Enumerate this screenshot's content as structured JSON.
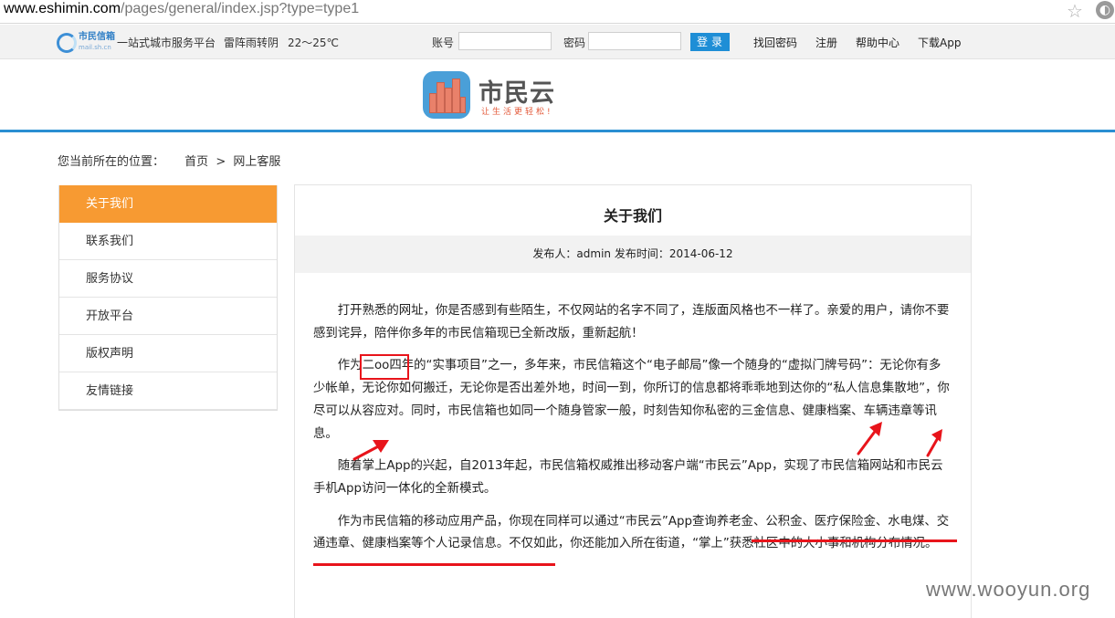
{
  "browser": {
    "url_domain": "www.eshimin.com",
    "url_path": "/pages/general/index.jsp?type=type1"
  },
  "topbar": {
    "logo_text": "市民信箱",
    "logo_sub": "mail.sh.cn",
    "slogan": "一站式城市服务平台",
    "weather": "雷阵雨转阴",
    "temperature": "22～25℃",
    "account_label": "账号",
    "account_value": "",
    "password_label": "密码",
    "password_value": "",
    "login_label": "登录",
    "links": [
      "找回密码",
      "注册",
      "帮助中心",
      "下载App"
    ]
  },
  "header": {
    "brand": "市民云",
    "brand_sub": "让生活更轻松!"
  },
  "breadcrumb": {
    "label": "您当前所在的位置：",
    "home": "首页",
    "separator": ">",
    "current": "网上客服"
  },
  "sidebar": {
    "items": [
      {
        "label": "关于我们",
        "active": true
      },
      {
        "label": "联系我们",
        "active": false
      },
      {
        "label": "服务协议",
        "active": false
      },
      {
        "label": "开放平台",
        "active": false
      },
      {
        "label": "版权声明",
        "active": false
      },
      {
        "label": "友情链接",
        "active": false
      }
    ]
  },
  "article": {
    "title": "关于我们",
    "meta": "发布人：admin  发布时间：2014-06-12",
    "paragraphs": [
      "打开熟悉的网址，你是否感到有些陌生，不仅网站的名字不同了，连版面风格也不一样了。亲爱的用户，请你不要感到诧异，陪伴你多年的市民信箱现已全新改版，重新起航！",
      "作为二oo四年的“实事项目”之一，多年来，市民信箱这个“电子邮局”像一个随身的“虚拟门牌号码”：无论你有多少帐单，无论你如何搬迁，无论你是否出差外地，时间一到，你所订的信息都将乖乖地到达你的“私人信息集散地”，你尽可以从容应对。同时，市民信箱也如同一个随身管家一般，时刻告知你私密的三金信息、健康档案、车辆违章等讯息。",
      "随着掌上App的兴起，自2013年起，市民信箱权威推出移动客户端“市民云”App，实现了市民信箱网站和市民云手机App访问一体化的全新模式。",
      "作为市民信箱的移动应用产品，你现在同样可以通过“市民云”App查询养老金、公积金、医疗保险金、水电煤、交通违章、健康档案等个人记录信息。不仅如此，你还能加入所在街道，“掌上”获悉社区中的大小事和机构分布情况。"
    ]
  },
  "annotation_color": "#e8141b",
  "accent_orange": "#f79a32",
  "accent_blue": "#2a8fd2",
  "watermark": "www.wooyun.org"
}
